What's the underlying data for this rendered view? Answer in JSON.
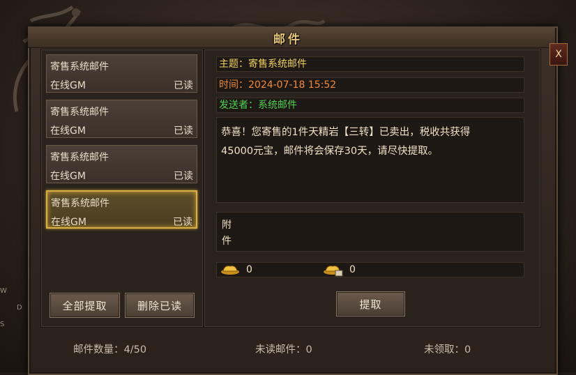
{
  "window": {
    "title": "邮件",
    "close_label": "X"
  },
  "mail_list": [
    {
      "subject": "寄售系统邮件",
      "sender": "在线GM",
      "status": "已读",
      "selected": false
    },
    {
      "subject": "寄售系统邮件",
      "sender": "在线GM",
      "status": "已读",
      "selected": false
    },
    {
      "subject": "寄售系统邮件",
      "sender": "在线GM",
      "status": "已读",
      "selected": false
    },
    {
      "subject": "寄售系统邮件",
      "sender": "在线GM",
      "status": "已读",
      "selected": true
    }
  ],
  "buttons": {
    "claim_all": "全部提取",
    "delete_read": "删除已读",
    "claim": "提取"
  },
  "detail": {
    "subject_label": "主题：",
    "subject_value": "寄售系统邮件",
    "time_label": "时间：",
    "time_value": "2024-07-18 15:52",
    "sender_label": "发送者：",
    "sender_value": "系统邮件",
    "body_line1": "恭喜！您寄售的1件天精岩【三转】已卖出，税收共获得",
    "body_line2": "45000元宝，邮件将会保存30天，请尽快提取。",
    "attachment_label": "附件"
  },
  "currency": [
    {
      "icon": "gold-ingot-icon",
      "amount": "0"
    },
    {
      "icon": "bound-ingot-icon",
      "amount": "0"
    }
  ],
  "footer": {
    "mail_count": "邮件数量：4/50",
    "unread": "未读邮件：0",
    "unclaimed": "未领取：0"
  },
  "colors": {
    "subject": "#f0d060",
    "time": "#f08a3a",
    "sender": "#50d050",
    "selected_border": "#d8b048"
  },
  "side_glyphs": [
    "W",
    "D",
    "S"
  ]
}
